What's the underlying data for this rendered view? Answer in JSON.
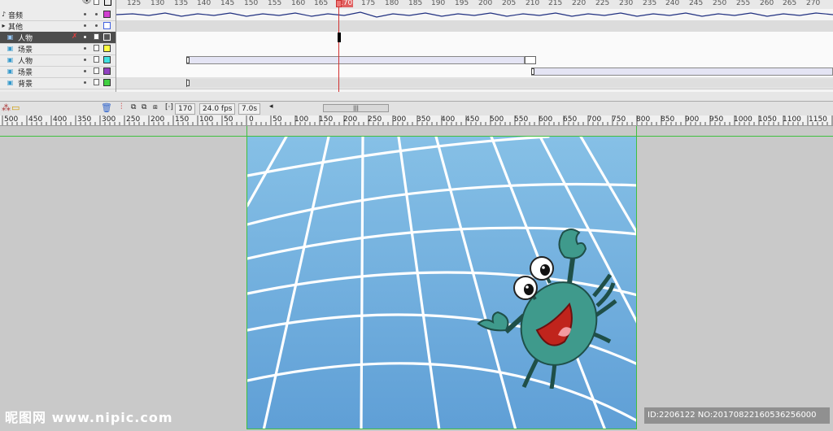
{
  "timeline": {
    "ruler_ticks": [
      "125",
      "130",
      "135",
      "140",
      "145",
      "150",
      "155",
      "160",
      "165",
      "170",
      "175",
      "180",
      "185",
      "190",
      "195",
      "200",
      "205",
      "210",
      "215",
      "220",
      "225",
      "230",
      "235",
      "240",
      "245",
      "250",
      "255",
      "260",
      "265",
      "270"
    ],
    "current_frame_marker": "170",
    "layers": [
      {
        "name": "音频",
        "color": "#d040d0"
      },
      {
        "name": "其他",
        "color": "#4060e0"
      },
      {
        "name": "人物",
        "color": "#303030",
        "selected": true
      },
      {
        "name": "场景",
        "color": "#ffff40"
      },
      {
        "name": "人物",
        "color": "#40e0e0"
      },
      {
        "name": "场景",
        "color": "#9040c0"
      },
      {
        "name": "背景",
        "color": "#40d040"
      }
    ],
    "footer": {
      "frame": "170",
      "fps": "24.0 fps",
      "time": "7.0s"
    }
  },
  "ruler": {
    "labels": [
      "500",
      "450",
      "400",
      "350",
      "300",
      "250",
      "200",
      "150",
      "100",
      "50",
      "0",
      "50",
      "100",
      "150",
      "200",
      "250",
      "300",
      "350",
      "400",
      "450",
      "500",
      "550",
      "600",
      "650",
      "700",
      "750",
      "800",
      "850",
      "900",
      "950",
      "1000",
      "1050",
      "1100",
      "1150"
    ]
  },
  "watermark": {
    "left": "昵图网 www.nipic.com",
    "right": "ID:2206122 NO:20170822160536256000"
  }
}
